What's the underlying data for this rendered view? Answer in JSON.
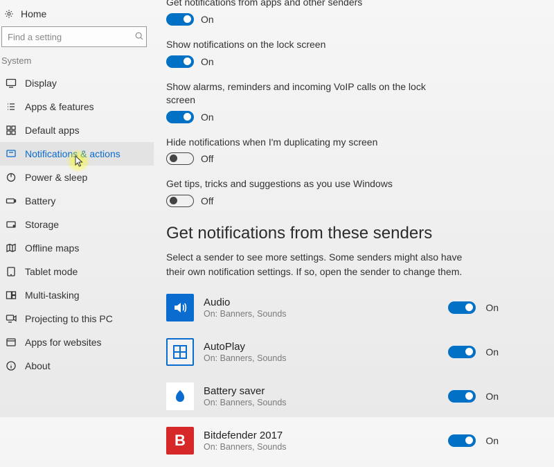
{
  "sidebar": {
    "home_label": "Home",
    "search_placeholder": "Find a setting",
    "section_label": "System",
    "items": [
      {
        "label": "Display"
      },
      {
        "label": "Apps & features"
      },
      {
        "label": "Default apps"
      },
      {
        "label": "Notifications & actions"
      },
      {
        "label": "Power & sleep"
      },
      {
        "label": "Battery"
      },
      {
        "label": "Storage"
      },
      {
        "label": "Offline maps"
      },
      {
        "label": "Tablet mode"
      },
      {
        "label": "Multi-tasking"
      },
      {
        "label": "Projecting to this PC"
      },
      {
        "label": "Apps for websites"
      },
      {
        "label": "About"
      }
    ]
  },
  "settings": {
    "cutoff_text": "Get notifications from apps and other senders",
    "items": [
      {
        "title": "",
        "state": "On",
        "on": true
      },
      {
        "title": "Show notifications on the lock screen",
        "state": "On",
        "on": true
      },
      {
        "title": "Show alarms, reminders and incoming VoIP calls on the lock screen",
        "state": "On",
        "on": true
      },
      {
        "title": "Hide notifications when I'm duplicating my screen",
        "state": "Off",
        "on": false
      },
      {
        "title": "Get tips, tricks and suggestions as you use Windows",
        "state": "Off",
        "on": false
      }
    ],
    "on_label": "On",
    "off_label": "Off"
  },
  "senders_section": {
    "heading": "Get notifications from these senders",
    "description": "Select a sender to see more settings. Some senders might also have their own notification settings. If so, open the sender to change them.",
    "items": [
      {
        "name": "Audio",
        "sub": "On: Banners, Sounds",
        "state": "On"
      },
      {
        "name": "AutoPlay",
        "sub": "On: Banners, Sounds",
        "state": "On"
      },
      {
        "name": "Battery saver",
        "sub": "On: Banners, Sounds",
        "state": "On"
      },
      {
        "name": "Bitdefender 2017",
        "sub": "On: Banners, Sounds",
        "state": "On"
      }
    ]
  }
}
